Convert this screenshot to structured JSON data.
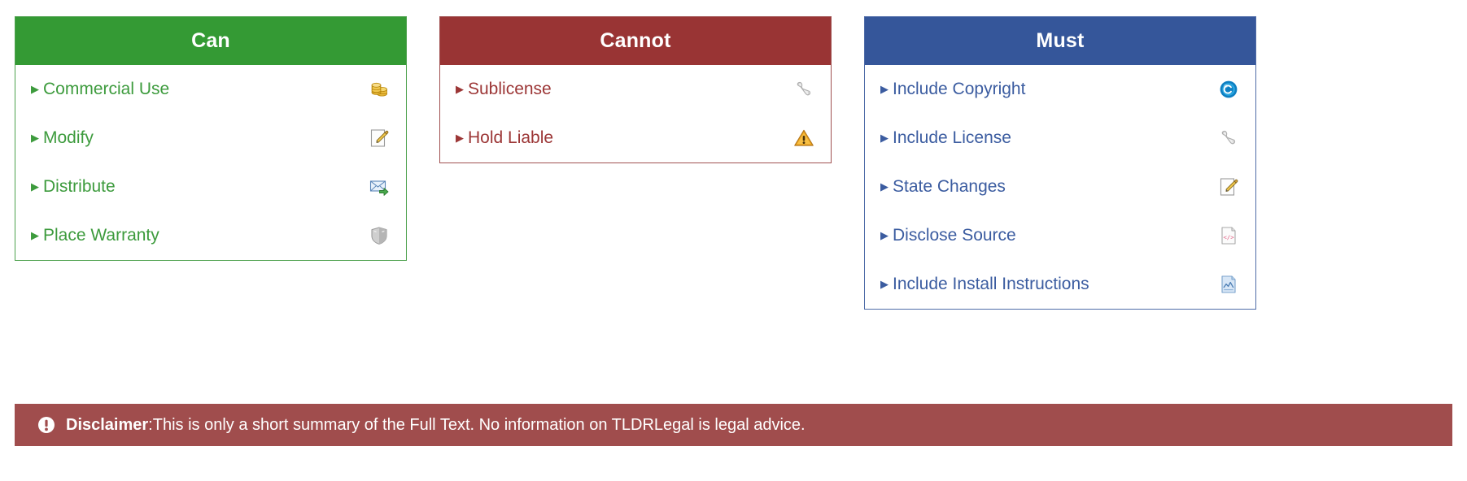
{
  "columns": [
    {
      "id": "can",
      "title": "Can",
      "accent": "#349a34",
      "items": [
        {
          "label": "Commercial Use",
          "icon": "coins-icon"
        },
        {
          "label": "Modify",
          "icon": "pencil-document-icon"
        },
        {
          "label": "Distribute",
          "icon": "envelope-forward-icon"
        },
        {
          "label": "Place Warranty",
          "icon": "shield-icon"
        }
      ]
    },
    {
      "id": "cannot",
      "title": "Cannot",
      "accent": "#993434",
      "items": [
        {
          "label": "Sublicense",
          "icon": "scroll-icon"
        },
        {
          "label": "Hold Liable",
          "icon": "warning-triangle-icon"
        }
      ]
    },
    {
      "id": "must",
      "title": "Must",
      "accent": "#35569a",
      "items": [
        {
          "label": "Include Copyright",
          "icon": "copyright-icon"
        },
        {
          "label": "Include License",
          "icon": "scroll-icon"
        },
        {
          "label": "State Changes",
          "icon": "pencil-document-icon"
        },
        {
          "label": "Disclose Source",
          "icon": "code-document-icon"
        },
        {
          "label": "Include Install Instructions",
          "icon": "blue-document-icon"
        }
      ]
    }
  ],
  "disclaimer": {
    "icon": "exclamation-icon",
    "label": "Disclaimer",
    "separator": ": ",
    "text": "This is only a short summary of the Full Text. No information on TLDRLegal is legal advice.",
    "background": "#a04d4d"
  },
  "caret": "▶"
}
